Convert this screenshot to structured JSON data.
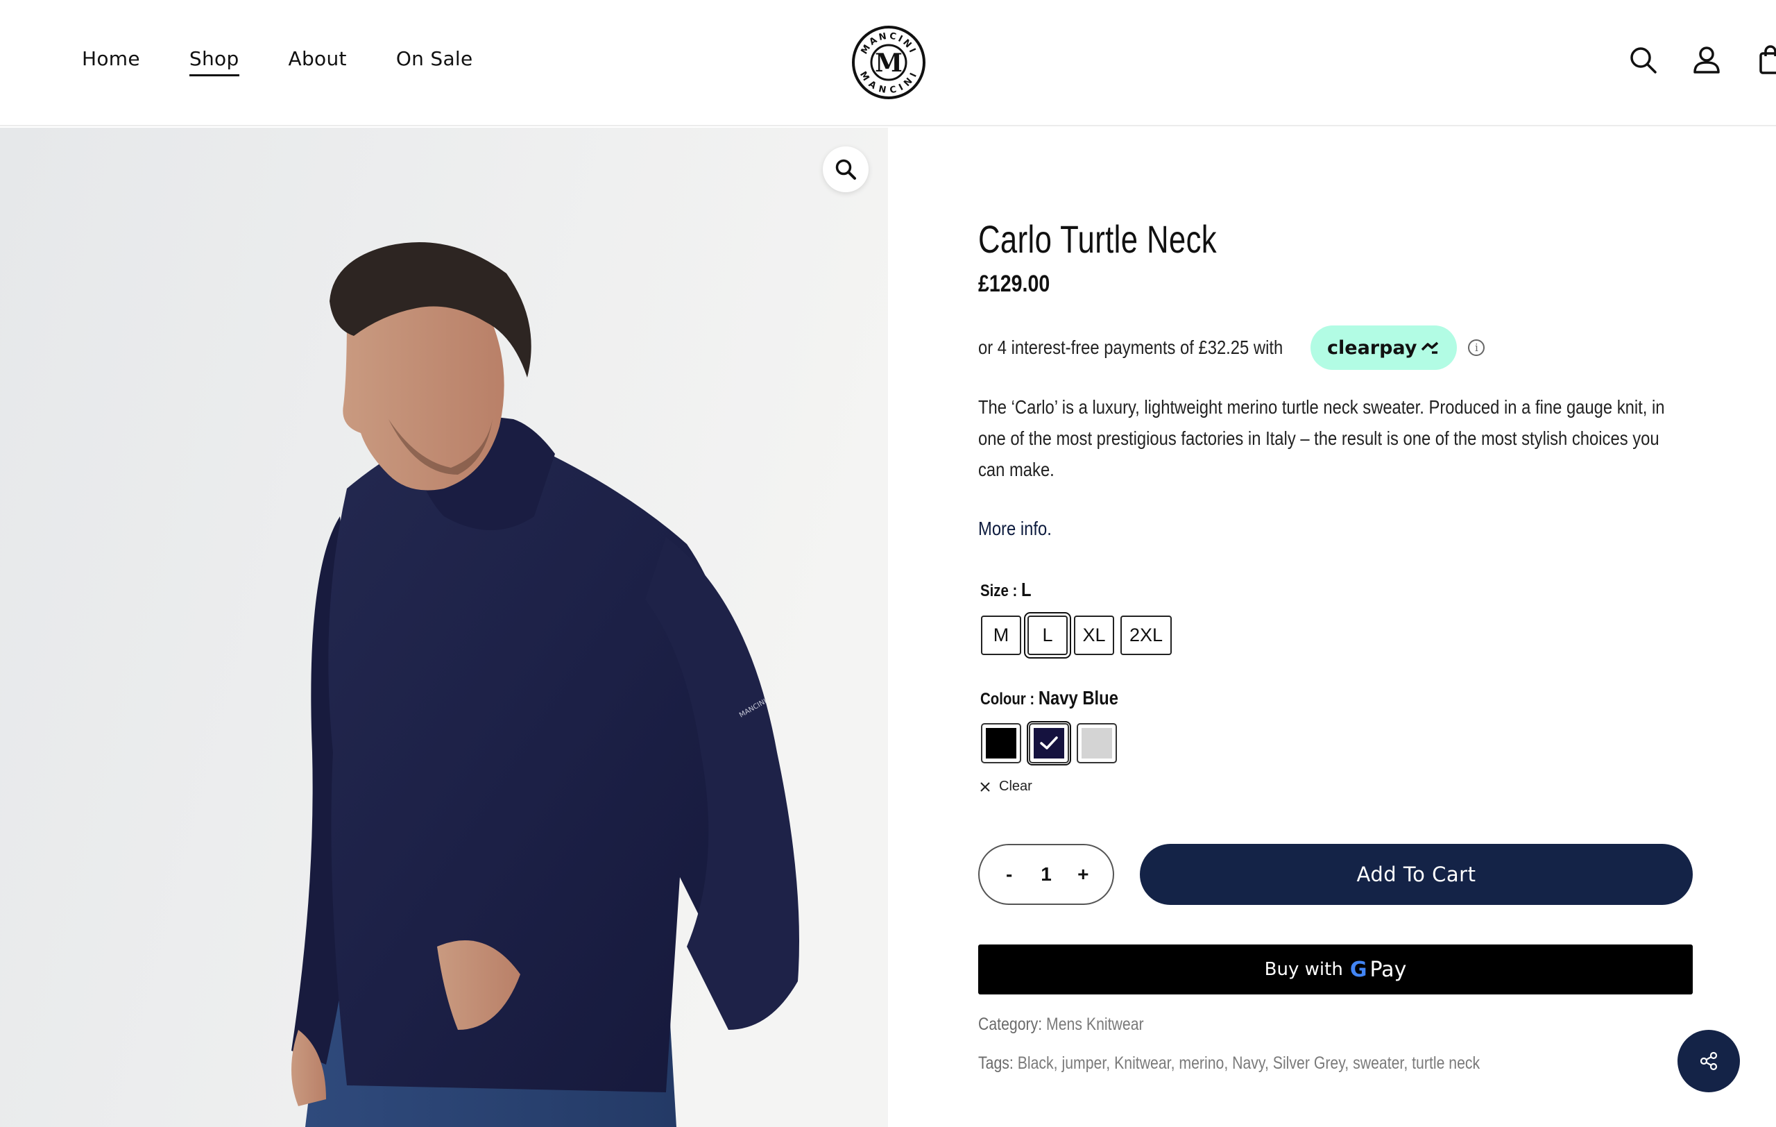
{
  "nav": {
    "items": [
      {
        "label": "Home"
      },
      {
        "label": "Shop"
      },
      {
        "label": "About"
      },
      {
        "label": "On Sale"
      }
    ]
  },
  "logo": {
    "ring_text": "MANCINI",
    "monogram": "M"
  },
  "product": {
    "title": "Carlo Turtle Neck",
    "price": "£129.00",
    "clearpay_text": "or 4 interest-free payments of £32.25 with",
    "clearpay_brand": "clearpay",
    "description": "The ‘Carlo’ is a luxury, lightweight merino turtle neck sweater.  Produced in a fine gauge knit, in one of the most prestigious factories in Italy – the result is one of the most stylish choices you can make.",
    "more_info": "More info.",
    "size_label": "Size :",
    "size_value": "L",
    "sizes": [
      "M",
      "L",
      "XL",
      "2XL"
    ],
    "colour_label": "Colour :",
    "colour_value": "Navy Blue",
    "colours": [
      {
        "name": "Black",
        "hex": "#000000"
      },
      {
        "name": "Navy",
        "hex": "#15123f"
      },
      {
        "name": "Silver Grey",
        "hex": "#d4d4d4"
      }
    ],
    "clear_label": "Clear",
    "quantity": "1",
    "qty_minus": "-",
    "qty_plus": "+",
    "add_to_cart": "Add To Cart",
    "gpay_prefix": "Buy with",
    "gpay_g": "G",
    "gpay_pay": "Pay",
    "category_label": "Category:",
    "category": "Mens Knitwear",
    "tags_label": "Tags:",
    "tags": "Black, jumper, Knitwear, merino, Navy, Silver Grey, sweater, turtle neck"
  },
  "colors": {
    "primary": "#142347",
    "clearpay": "#b2fce4",
    "sweater": "#1b1f44"
  },
  "icons": [
    "search-icon",
    "account-icon",
    "bag-icon",
    "zoom-icon",
    "info-icon",
    "check-icon",
    "close-icon",
    "share-icon"
  ]
}
